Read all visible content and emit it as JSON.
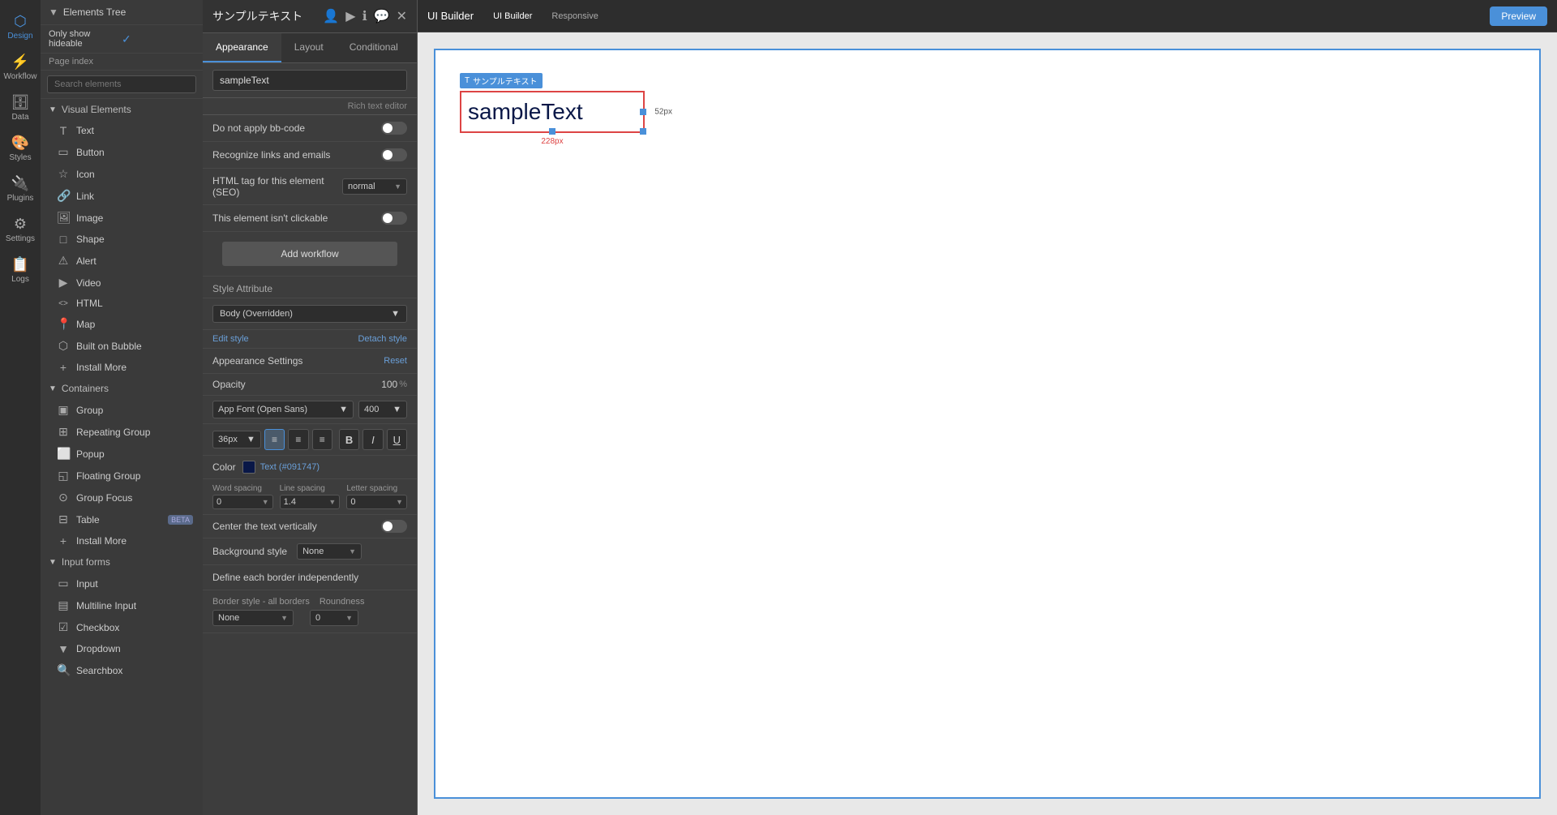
{
  "app": {
    "title": "UI Builder",
    "responsive_tab": "Responsive"
  },
  "left_nav": {
    "items": [
      {
        "id": "design",
        "label": "Design",
        "icon": "⬡",
        "active": true
      },
      {
        "id": "workflow",
        "label": "Workflow",
        "icon": "⚡"
      },
      {
        "id": "data",
        "label": "Data",
        "icon": "🗄"
      },
      {
        "id": "styles",
        "label": "Styles",
        "icon": "🎨"
      },
      {
        "id": "plugins",
        "label": "Plugins",
        "icon": "🔌"
      },
      {
        "id": "settings",
        "label": "Settings",
        "icon": "⚙"
      },
      {
        "id": "logs",
        "label": "Logs",
        "icon": "📋"
      }
    ]
  },
  "elements_panel": {
    "title": "Elements Tree",
    "only_show_hideable": "Only show hideable",
    "page_index": "Page index",
    "search_placeholder": "Search elements",
    "visual_elements_section": "Visual Elements",
    "containers_section": "Containers",
    "input_forms_section": "Input forms",
    "elements": [
      {
        "id": "text",
        "label": "Text",
        "icon": "T"
      },
      {
        "id": "button",
        "label": "Button",
        "icon": "▭"
      },
      {
        "id": "icon",
        "label": "Icon",
        "icon": "☆"
      },
      {
        "id": "link",
        "label": "Link",
        "icon": "🔗"
      },
      {
        "id": "image",
        "label": "Image",
        "icon": "🖼"
      },
      {
        "id": "shape",
        "label": "Shape",
        "icon": "□"
      },
      {
        "id": "alert",
        "label": "Alert",
        "icon": "⚠"
      },
      {
        "id": "video",
        "label": "Video",
        "icon": "▶"
      },
      {
        "id": "html",
        "label": "HTML",
        "icon": "<>"
      },
      {
        "id": "map",
        "label": "Map",
        "icon": "📍"
      },
      {
        "id": "built-on-bubble",
        "label": "Built on Bubble",
        "icon": "⬡"
      },
      {
        "id": "install-more-ve",
        "label": "Install More",
        "icon": "+"
      }
    ],
    "containers": [
      {
        "id": "group",
        "label": "Group",
        "icon": "▣"
      },
      {
        "id": "repeating-group",
        "label": "Repeating Group",
        "icon": "⊞"
      },
      {
        "id": "popup",
        "label": "Popup",
        "icon": "⬜"
      },
      {
        "id": "floating-group",
        "label": "Floating Group",
        "icon": "◱"
      },
      {
        "id": "group-focus",
        "label": "Group Focus",
        "icon": "⊙"
      },
      {
        "id": "table",
        "label": "Table",
        "icon": "⊟",
        "badge": "BETA"
      },
      {
        "id": "install-more-c",
        "label": "Install More",
        "icon": "+"
      }
    ],
    "input_forms": [
      {
        "id": "input",
        "label": "Input",
        "icon": "▭"
      },
      {
        "id": "multiline-input",
        "label": "Multiline Input",
        "icon": "▤"
      },
      {
        "id": "checkbox",
        "label": "Checkbox",
        "icon": "☑"
      },
      {
        "id": "dropdown",
        "label": "Dropdown",
        "icon": "▼"
      },
      {
        "id": "searchbox",
        "label": "Searchbox",
        "icon": "🔍"
      }
    ]
  },
  "properties_panel": {
    "title": "サンプルテキスト",
    "tabs": [
      {
        "id": "appearance",
        "label": "Appearance",
        "active": true
      },
      {
        "id": "layout",
        "label": "Layout"
      },
      {
        "id": "conditional",
        "label": "Conditional"
      }
    ],
    "element_name": "sampleText",
    "rich_text_editor": "Rich text editor",
    "do_not_apply_bb_code": "Do not apply bb-code",
    "recognize_links": "Recognize links and emails",
    "html_tag_label": "HTML tag for this element (SEO)",
    "html_tag_value": "normal",
    "not_clickable": "This element isn't clickable",
    "add_workflow": "Add workflow",
    "style_attribute_label": "Style Attribute",
    "style_attribute_value": "Body (Overridden)",
    "edit_style": "Edit style",
    "detach_style": "Detach style",
    "appearance_settings": "Appearance Settings",
    "reset": "Reset",
    "opacity_label": "Opacity",
    "opacity_value": "100",
    "opacity_unit": "%",
    "font_label": "App Font (Open Sans)",
    "font_weight": "400",
    "font_size": "36px",
    "align_left": "≡",
    "align_center": "≡",
    "align_right": "≡",
    "bold": "B",
    "italic": "I",
    "underline": "U",
    "color_label": "Color",
    "color_hex": "#091747",
    "color_text": "Text (#091747)",
    "word_spacing_label": "Word spacing",
    "line_spacing_label": "Line spacing",
    "letter_spacing_label": "Letter spacing",
    "word_spacing_val": "0",
    "line_spacing_val": "1.4",
    "letter_spacing_val": "0",
    "center_vert": "Center the text vertically",
    "bg_style_label": "Background style",
    "bg_style_value": "None",
    "define_border": "Define each border independently",
    "border_style_label": "Border style - all borders",
    "border_roundness_label": "Roundness",
    "border_style_value": "None",
    "border_roundness_value": "0"
  },
  "canvas": {
    "element_tag": "T サンプルテキスト",
    "element_text": "sampleText",
    "width_label": "228px",
    "height_label": "52px"
  }
}
